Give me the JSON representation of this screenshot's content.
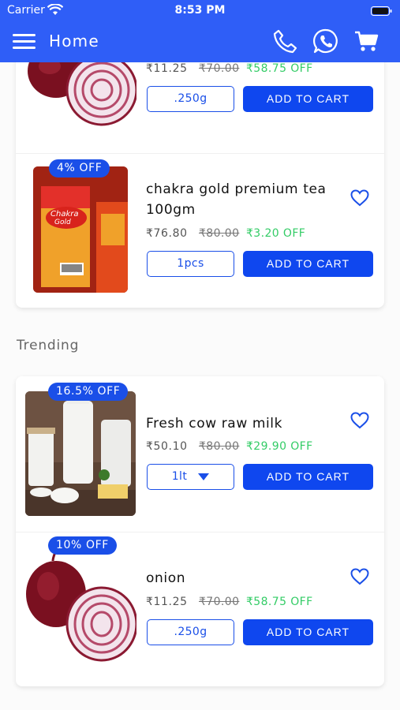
{
  "status_bar": {
    "carrier": "Carrier",
    "time": "8:53 PM"
  },
  "header": {
    "title": "Home",
    "icons": [
      "menu-icon",
      "phone-icon",
      "whatsapp-icon",
      "cart-icon"
    ],
    "color": "#2f5ef7"
  },
  "section": {
    "trending_title": "Trending"
  },
  "top_products": [
    {
      "name": "onion",
      "price": "₹11.25",
      "mrp": "₹70.00",
      "off": "₹58.75 OFF",
      "qty": ".250g",
      "add_label": "ADD TO CART"
    },
    {
      "badge": "4% OFF",
      "name_line1": "chakra gold premium tea",
      "name_line2": "100gm",
      "price": "₹76.80",
      "mrp": "₹80.00",
      "off": "₹3.20 OFF",
      "qty": "1pcs",
      "add_label": "ADD TO CART"
    }
  ],
  "trending_products": [
    {
      "badge": "16.5% OFF",
      "name": "Fresh cow raw milk",
      "price": "₹50.10",
      "mrp": "₹80.00",
      "off": "₹29.90 OFF",
      "qty": "1lt",
      "add_label": "ADD TO CART"
    },
    {
      "badge": "10% OFF",
      "name": "onion",
      "price": "₹11.25",
      "mrp": "₹70.00",
      "off": "₹58.75 OFF",
      "qty": ".250g",
      "add_label": "ADD TO CART"
    }
  ],
  "colors": {
    "accent": "#1a4fe8",
    "discount": "#33cc66",
    "button": "#0f47ef"
  }
}
